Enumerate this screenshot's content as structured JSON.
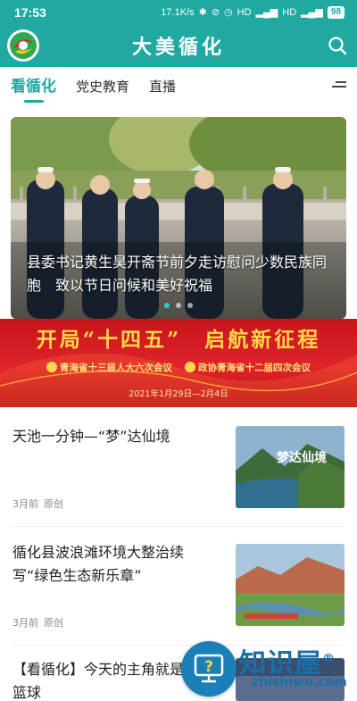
{
  "status_bar": {
    "time": "17:53",
    "network_speed": "17.1K/s",
    "battery": "98"
  },
  "header": {
    "title": "大美循化"
  },
  "tabs": [
    {
      "label": "看循化",
      "active": true
    },
    {
      "label": "党史教育",
      "active": false
    },
    {
      "label": "直播",
      "active": false
    }
  ],
  "carousel": {
    "caption": "县委书记黄生昊开斋节前夕走访慰问少数民族同胞　致以节日问候和美好祝福",
    "slide_count": 3,
    "active_index": 0
  },
  "banner": {
    "headline": "开局“十四五”　启航新征程",
    "sub_left": "青海省十三届人大六次会议",
    "sub_right": "政协青海省十二届四次会议",
    "date": "2021年1月29日—2月4日"
  },
  "news": [
    {
      "title": "天池一分钟—“梦”达仙境",
      "time": "3月前",
      "tag": "原创",
      "thumb_text": "梦达仙境"
    },
    {
      "title": "循化县波浪滩环境大整治续写“绿色生态新乐章”",
      "time": "3月前",
      "tag": "原创"
    },
    {
      "title": "【看循化】今天的主角就是循化篮球"
    }
  ],
  "watermark": {
    "big": "知识屋",
    "small": "zhishiwu.com",
    "mark": "®"
  },
  "colors": {
    "brand": "#1fa9a0",
    "banner_red": "#d41c22",
    "banner_gold": "#ffd94a"
  }
}
